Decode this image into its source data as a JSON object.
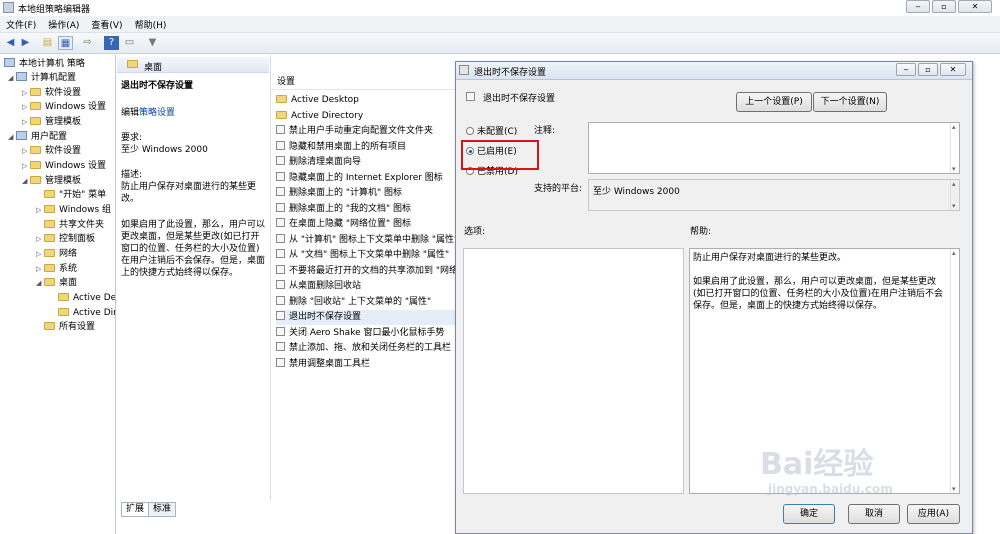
{
  "window": {
    "title": "本地组策略编辑器"
  },
  "menu": [
    "文件(F)",
    "操作(A)",
    "查看(V)",
    "帮助(H)"
  ],
  "tree": {
    "root": "本地计算机 策略",
    "items": [
      {
        "label": "计算机配置"
      },
      {
        "label": "软件设置"
      },
      {
        "label": "Windows 设置"
      },
      {
        "label": "管理模板"
      },
      {
        "label": "用户配置"
      },
      {
        "label": "软件设置"
      },
      {
        "label": "Windows 设置"
      },
      {
        "label": "管理模板"
      },
      {
        "label": "\"开始\" 菜单"
      },
      {
        "label": "Windows 组"
      },
      {
        "label": "共享文件夹"
      },
      {
        "label": "控制面板"
      },
      {
        "label": "网络"
      },
      {
        "label": "系统"
      },
      {
        "label": "桌面"
      },
      {
        "label": "Active De"
      },
      {
        "label": "Active Dir"
      },
      {
        "label": "所有设置"
      }
    ]
  },
  "description": {
    "header": "桌面",
    "title": "退出时不保存设置",
    "edit_prefix": "编辑",
    "edit_link": "策略设置",
    "req_label": "要求:",
    "req_value": "至少 Windows 2000",
    "desc_label": "描述:",
    "desc_value": "防止用户保存对桌面进行的某些更改。",
    "body": "如果启用了此设置，那么，用户可以更改桌面，但是某些更改(如已打开窗口的位置、任务栏的大小及位置)在用户注销后不会保存。但是，桌面上的快捷方式始终得以保存。"
  },
  "settings_list": {
    "header": "设置",
    "items": [
      "Active Desktop",
      "Active Directory",
      "禁止用户手动重定向配置文件文件夹",
      "隐藏和禁用桌面上的所有项目",
      "删除清理桌面向导",
      "隐藏桌面上的 Internet Explorer 图标",
      "删除桌面上的 \"计算机\" 图标",
      "删除桌面上的 \"我的文档\" 图标",
      "在桌面上隐藏 \"网络位置\" 图标",
      "从 \"计算机\" 图标上下文菜单中删除 \"属性\"",
      "从 \"文档\" 图标上下文菜单中删除 \"属性\"",
      "不要将最近打开的文档的共享添加到 \"网络位置\"",
      "从桌面删除回收站",
      "删除 \"回收站\" 上下文菜单的 \"属性\"",
      "退出时不保存设置",
      "关闭 Aero Shake 窗口最小化鼠标手势",
      "禁止添加、拖、放和关闭任务栏的工具栏",
      "禁用调整桌面工具栏"
    ]
  },
  "tabs": [
    "扩展",
    "标准"
  ],
  "dialog": {
    "title": "退出时不保存设置",
    "subtitle": "退出时不保存设置",
    "prev_btn": "上一个设置(P)",
    "next_btn": "下一个设置(N)",
    "radio_not_configured": "未配置(C)",
    "radio_enabled": "已启用(E)",
    "radio_disabled": "已禁用(D)",
    "selected": "已启用(E)",
    "comment_label": "注释:",
    "platform_label": "支持的平台:",
    "platform_value": "至少 Windows 2000",
    "options_label": "选项:",
    "help_label": "帮助:",
    "help_p1": "防止用户保存对桌面进行的某些更改。",
    "help_p2": "如果启用了此设置，那么，用户可以更改桌面，但是某些更改(如已打开窗口的位置、任务栏的大小及位置)在用户注销后不会保存。但是，桌面上的快捷方式始终得以保存。",
    "ok": "确定",
    "cancel": "取消",
    "apply": "应用(A)"
  },
  "watermark": {
    "brand": "Bai经验",
    "url": "jingyan.baidu.com"
  },
  "colors": {
    "highlight": "#d01818",
    "link": "#0645ad"
  }
}
